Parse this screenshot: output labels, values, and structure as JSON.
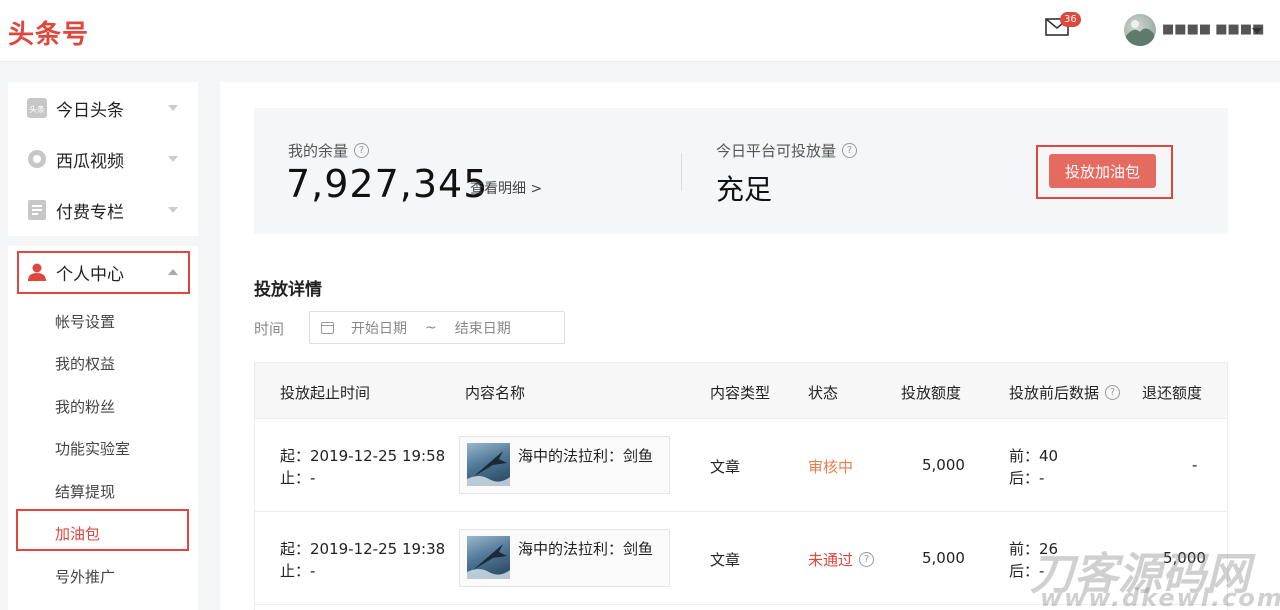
{
  "header": {
    "logo": "头条号",
    "mail_badge": "36",
    "username": "■■■■ ■■■■"
  },
  "sidebar": {
    "main_items": [
      {
        "label": "今日头条",
        "icon": "toutiao-icon"
      },
      {
        "label": "西瓜视频",
        "icon": "xigua-icon"
      },
      {
        "label": "付费专栏",
        "icon": "column-icon"
      }
    ],
    "personal_center": {
      "label": "个人中心",
      "icon": "user-icon"
    },
    "sub_items": [
      {
        "label": "帐号设置"
      },
      {
        "label": "我的权益"
      },
      {
        "label": "我的粉丝"
      },
      {
        "label": "功能实验室"
      },
      {
        "label": "结算提现"
      },
      {
        "label": "加油包",
        "active": true
      },
      {
        "label": "号外推广"
      }
    ]
  },
  "stats": {
    "balance_label": "我的余量",
    "balance_value": "7,927,345",
    "detail_link": "查看明细 >",
    "platform_label": "今日平台可投放量",
    "platform_value": "充足",
    "buy_button": "投放加油包"
  },
  "details": {
    "title": "投放详情",
    "time_label": "时间",
    "start_placeholder": "开始日期",
    "separator": "~",
    "end_placeholder": "结束日期"
  },
  "table": {
    "headers": {
      "time": "投放起止时间",
      "content": "内容名称",
      "type": "内容类型",
      "status": "状态",
      "amount": "投放额度",
      "data": "投放前后数据",
      "refund": "退还额度"
    },
    "rows": [
      {
        "start": "起：2019-12-25 19:58",
        "end": "止：-",
        "title": "海中的法拉利：剑鱼",
        "type": "文章",
        "status": "审核中",
        "amount": "5,000",
        "before": "前：40",
        "after": "后：-",
        "refund": "-"
      },
      {
        "start": "起：2019-12-25 19:38",
        "end": "止：-",
        "title": "海中的法拉利：剑鱼",
        "type": "文章",
        "status": "未通过",
        "amount": "5,000",
        "before": "前：26",
        "after": "后：-",
        "refund": "5,000"
      }
    ]
  },
  "watermark": {
    "main": "刀客源码网",
    "sub": "www.dkewl.com"
  },
  "colors": {
    "brand": "#e0463c",
    "button": "#e56a60",
    "status_review": "#e87d4d",
    "status_reject": "#e0463c"
  }
}
